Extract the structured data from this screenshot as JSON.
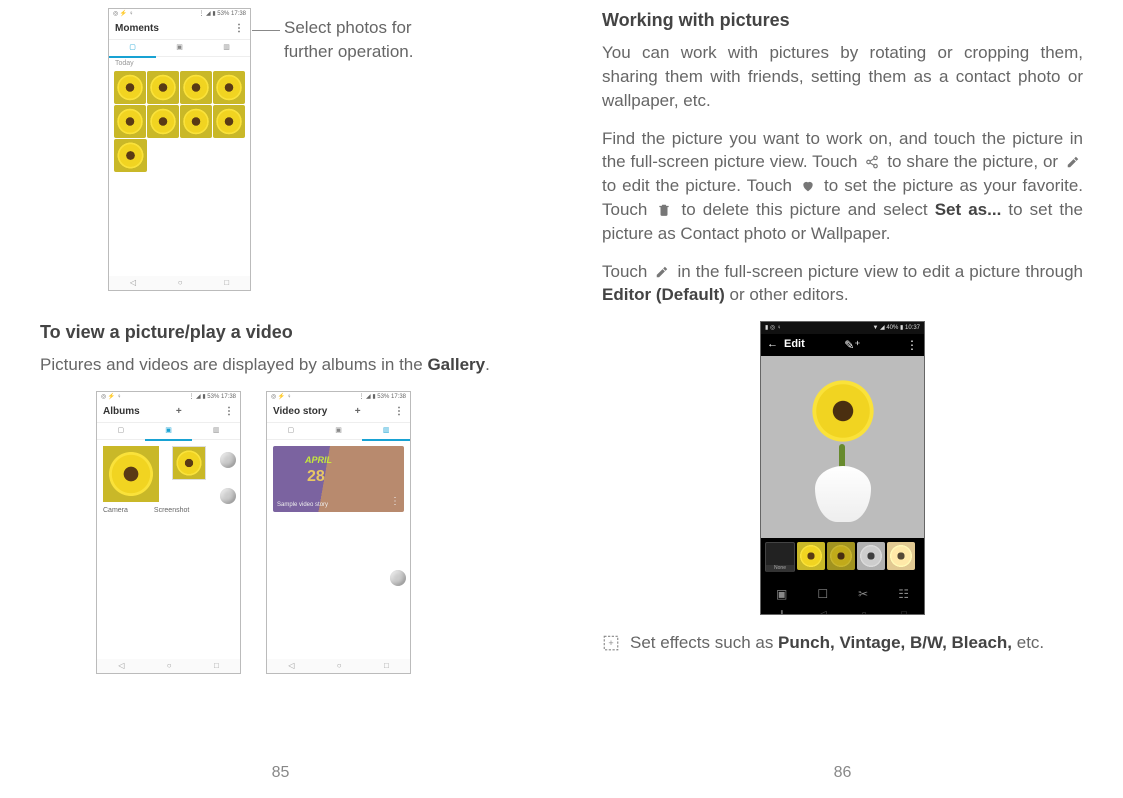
{
  "left": {
    "callout": "Select photos for further operation.",
    "moments": {
      "status_left": "◎ ⚡ ♀",
      "status_right": "⋮ ◢ ▮ 53% 17:38",
      "title": "Moments",
      "today": "Today",
      "tab_icons": [
        "photo-icon",
        "album-icon",
        "video-icon"
      ]
    },
    "heading": "To view a picture/play a video",
    "para": [
      "Pictures and videos are displayed by albums in the ",
      "Gallery",
      "."
    ],
    "albums": {
      "title": "Albums",
      "status_left": "◎ ⚡ ♀",
      "status_right": "⋮ ◢ ▮ 53% 17:38",
      "labels": [
        "Camera",
        "Screenshot"
      ]
    },
    "videostory": {
      "title": "Video story",
      "status_left": "◎ ⚡ ♀",
      "status_right": "⋮ ◢ ▮ 53% 17:38",
      "card_month": "APRIL",
      "card_day": "28",
      "card_caption": "Sample video story"
    },
    "page_number": "85"
  },
  "right": {
    "heading": "Working with pictures",
    "p1": "You can work with pictures by rotating or cropping them, sharing them with friends, setting them as a contact photo or wallpaper, etc.",
    "p2a": "Find the picture you want to work on, and touch the picture in the full-screen picture view. Touch ",
    "p2b": " to share the picture, or ",
    "p2c": " to edit the picture. Touch ",
    "p2d": " to set the picture as your favorite. Touch ",
    "p2e": " to delete this picture and select ",
    "p2_setas": "Set as...",
    "p2f": " to set the picture as Contact photo or Wallpaper.",
    "p3a": "Touch ",
    "p3b": " in the full-screen picture view to edit a picture through ",
    "p3_editor": "Editor (Default)",
    "p3c": " or other editors.",
    "edit": {
      "status_left": "▮ ◎ ♀",
      "status_right": "▼ ◢ 40% ▮ 10:37",
      "title": "Edit",
      "orig_label": "None"
    },
    "bullet": [
      "Set effects such as ",
      "Punch, Vintage, B/W, Bleach,",
      " etc."
    ],
    "page_number": "86"
  }
}
